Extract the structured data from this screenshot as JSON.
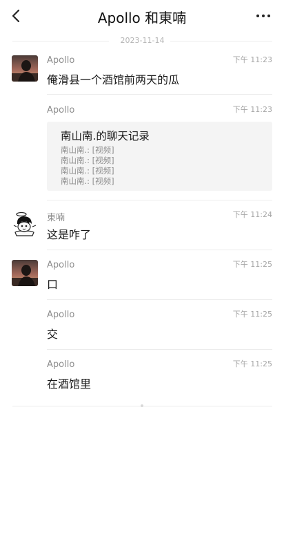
{
  "header": {
    "title": "Apollo 和東喃",
    "back_icon": "chevron-left-icon",
    "more_icon": "more-horizontal-icon"
  },
  "date_separator": "2023-11-14",
  "messages": [
    {
      "sender": "Apollo",
      "time": "下午 11:23",
      "text": "俺滑县一个酒馆前两天的瓜",
      "avatar": "apollo-avatar"
    },
    {
      "sender": "Apollo",
      "time": "下午 11:23",
      "card": {
        "title": "南山南.的聊天记录",
        "lines": [
          "南山南.: [视频]",
          "南山南.: [视频]",
          "南山南.: [视频]",
          "南山南.: [视频]"
        ]
      }
    },
    {
      "sender": "東喃",
      "time": "下午 11:24",
      "text": "这是咋了",
      "avatar": "donan-avatar"
    },
    {
      "sender": "Apollo",
      "time": "下午 11:25",
      "text": "口",
      "avatar": "apollo-avatar"
    },
    {
      "sender": "Apollo",
      "time": "下午 11:25",
      "text": "交"
    },
    {
      "sender": "Apollo",
      "time": "下午 11:25",
      "text": "在酒馆里"
    }
  ],
  "colors": {
    "background": "#ffffff",
    "meta_gray": "#8e8e8e",
    "card_bg": "#f4f4f4"
  }
}
